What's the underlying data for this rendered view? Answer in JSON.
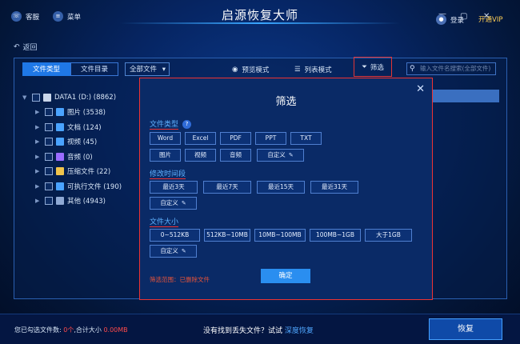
{
  "window": {
    "title": "启源恢复大师",
    "service_label": "客服",
    "menu_label": "菜单",
    "login_label": "登录",
    "vip_label": "开通VIP"
  },
  "nav": {
    "back_label": "返回"
  },
  "toolbar": {
    "tab_file_type": "文件类型",
    "tab_file_dir": "文件目录",
    "select_all_files": "全部文件",
    "preview_mode": "预览模式",
    "list_mode": "列表模式",
    "filter_label": "筛选",
    "search_placeholder": "输入文件名搜索(全部文件)"
  },
  "tree": {
    "root": "DATA1 (D:) (8862)",
    "items": [
      {
        "label": "图片 (3538)",
        "color": "#4aa3ff"
      },
      {
        "label": "文档 (124)",
        "color": "#4aa3ff"
      },
      {
        "label": "视频 (45)",
        "color": "#4aa3ff"
      },
      {
        "label": "音频 (0)",
        "color": "#9a6cff"
      },
      {
        "label": "压缩文件 (22)",
        "color": "#f0c44c"
      },
      {
        "label": "可执行文件 (190)",
        "color": "#4aa3ff"
      },
      {
        "label": "其他 (4943)",
        "color": "#8fa9d4"
      }
    ]
  },
  "dialog": {
    "title": "筛选",
    "section_type": "文件类型",
    "type_options_row1": [
      "Word",
      "Excel",
      "PDF",
      "PPT",
      "TXT"
    ],
    "type_options_row2": [
      "图片",
      "视频",
      "音频"
    ],
    "type_custom": "自定义",
    "section_time": "修改时间段",
    "time_options": [
      "最近3天",
      "最近7天",
      "最近15天",
      "最近31天"
    ],
    "time_custom": "自定义",
    "section_size": "文件大小",
    "size_options": [
      "0~512KB",
      "512KB~10MB",
      "10MB~100MB",
      "100MB~1GB",
      "大于1GB"
    ],
    "size_custom": "自定义",
    "scope_text": "筛选范围：已删除文件",
    "confirm_label": "确定"
  },
  "bottom": {
    "selected_prefix": "您已勾选文件数:",
    "selected_count": "0个",
    "size_prefix": ",合计大小",
    "size_value": "0.00MB",
    "missing_text": "没有找到丢失文件？试试",
    "deep_recover": "深度恢复",
    "recover_label": "恢复"
  }
}
